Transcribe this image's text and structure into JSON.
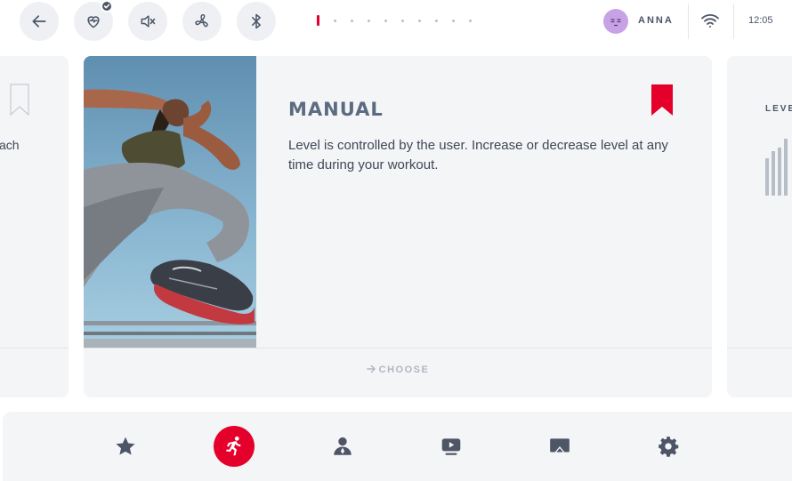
{
  "topbar": {
    "user_name": "ANNA",
    "time": "12:05",
    "pager_total": 10,
    "pager_active": 1,
    "icons": [
      "back-arrow-icon",
      "heart-rate-icon",
      "speaker-mute-icon",
      "fan-icon",
      "bluetooth-icon"
    ]
  },
  "cards": {
    "left": {
      "text_fragment": "ach"
    },
    "main": {
      "title": "MANUAL",
      "description": "Level is controlled by the user. Increase or decrease level at any time during your workout.",
      "choose_label": "CHOOSE",
      "bookmarked": true
    },
    "right": {
      "label_fragment": "LEVE"
    }
  },
  "bottom_nav": {
    "items": [
      "favorites",
      "workouts",
      "profile",
      "video",
      "screen-mirror",
      "settings"
    ],
    "active": "workouts"
  },
  "colors": {
    "accent": "#e4002b",
    "card_bg": "#f4f5f7",
    "icon": "#4d5566",
    "title": "#5b6b80"
  }
}
